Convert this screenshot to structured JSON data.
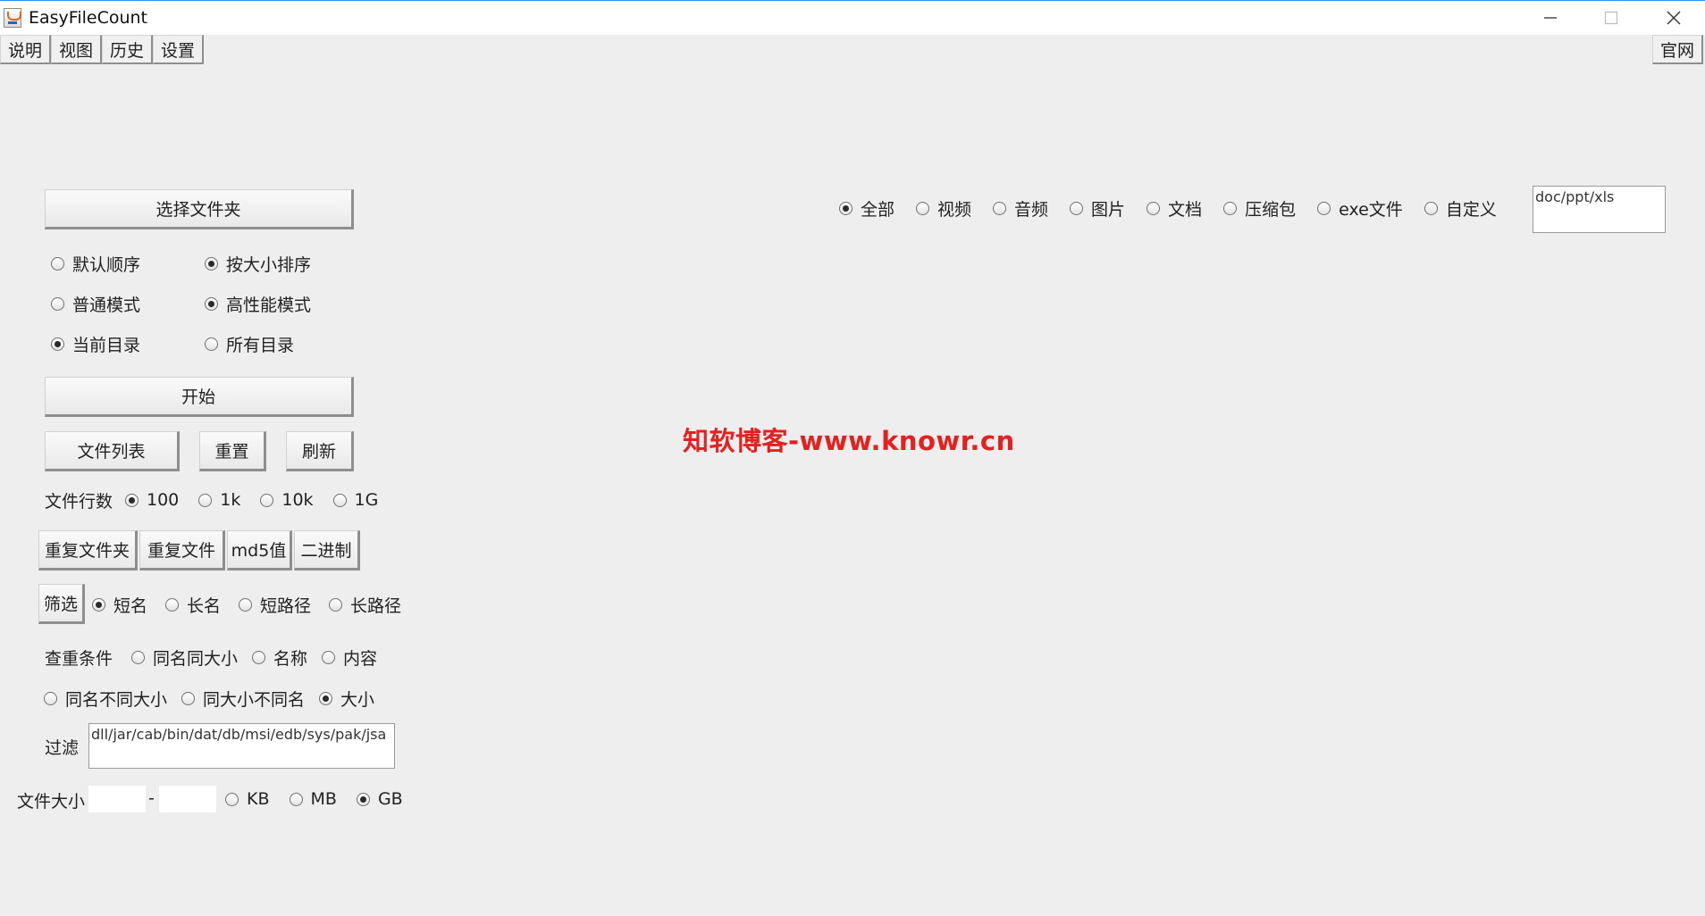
{
  "window": {
    "title": "EasyFileCount",
    "minimize_icon": "minimize-icon",
    "maximize_icon": "maximize-icon",
    "close_icon": "close-icon"
  },
  "menubar": {
    "items": [
      "说明",
      "视图",
      "历史",
      "设置"
    ],
    "official": "官网"
  },
  "left": {
    "select_folder": "选择文件夹",
    "sort": {
      "default": "默认顺序",
      "by_size": "按大小排序",
      "selected": "by_size"
    },
    "mode": {
      "normal": "普通模式",
      "high": "高性能模式",
      "selected": "high"
    },
    "scope": {
      "current": "当前目录",
      "all": "所有目录",
      "selected": "current"
    },
    "start": "开始",
    "file_list": "文件列表",
    "reset": "重置",
    "refresh": "刷新",
    "lines_label": "文件行数",
    "lines": [
      "100",
      "1k",
      "10k",
      "1G"
    ],
    "lines_selected": "100",
    "dup_folder": "重复文件夹",
    "dup_file": "重复文件",
    "md5": "md5值",
    "binary": "二进制",
    "filter_btn": "筛选",
    "name_opts": [
      "短名",
      "长名",
      "短路径",
      "长路径"
    ],
    "name_selected": "短名",
    "dup_cond_label": "查重条件",
    "dup_cond1": [
      "同名同大小",
      "名称",
      "内容"
    ],
    "dup_cond2": [
      "同名不同大小",
      "同大小不同名",
      "大小"
    ],
    "dup_cond_selected": "大小",
    "filter_label": "过滤",
    "filter_value": "dll/jar/cab/bin/dat/db/msi/edb/sys/pak/jsa",
    "size_label": "文件大小",
    "size_min": "",
    "size_dash": "-",
    "size_max": "",
    "size_units": [
      "KB",
      "MB",
      "GB"
    ],
    "size_unit_selected": "GB"
  },
  "types": {
    "options": [
      "全部",
      "视频",
      "音频",
      "图片",
      "文档",
      "压缩包",
      "exe文件",
      "自定义"
    ],
    "selected": "全部",
    "custom_value": "doc/ppt/xls"
  },
  "watermark": "知软博客-www.knowr.cn"
}
